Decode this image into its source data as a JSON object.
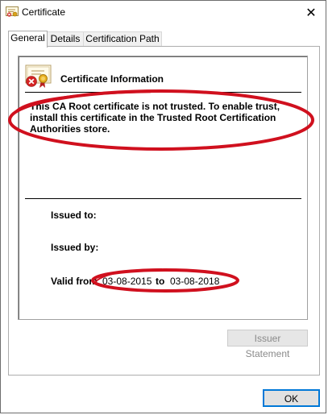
{
  "window": {
    "title": "Certificate",
    "close_glyph": "✕"
  },
  "tabs": [
    {
      "label": "General",
      "active": true
    },
    {
      "label": "Details",
      "active": false
    },
    {
      "label": "Certification Path",
      "active": false
    }
  ],
  "info": {
    "title": "Certificate Information",
    "warning": "This CA Root certificate is not trusted. To enable trust, install this certificate in the Trusted Root Certification Authorities store.",
    "issued_to_label": "Issued to:",
    "issued_by_label": "Issued by:",
    "valid_from_label": "Valid from",
    "valid_from": "03-08-2015",
    "to_word": "to",
    "valid_to": "03-08-2018"
  },
  "buttons": {
    "issuer_statement": "Issuer Statement",
    "ok": "OK"
  },
  "icons": {
    "title": "certificate-icon",
    "info": "untrusted-certificate-icon",
    "close": "close-icon"
  },
  "colors": {
    "annotation_red": "#d0101e",
    "ok_border": "#0078d7",
    "disabled_text": "#8a8a8a"
  }
}
